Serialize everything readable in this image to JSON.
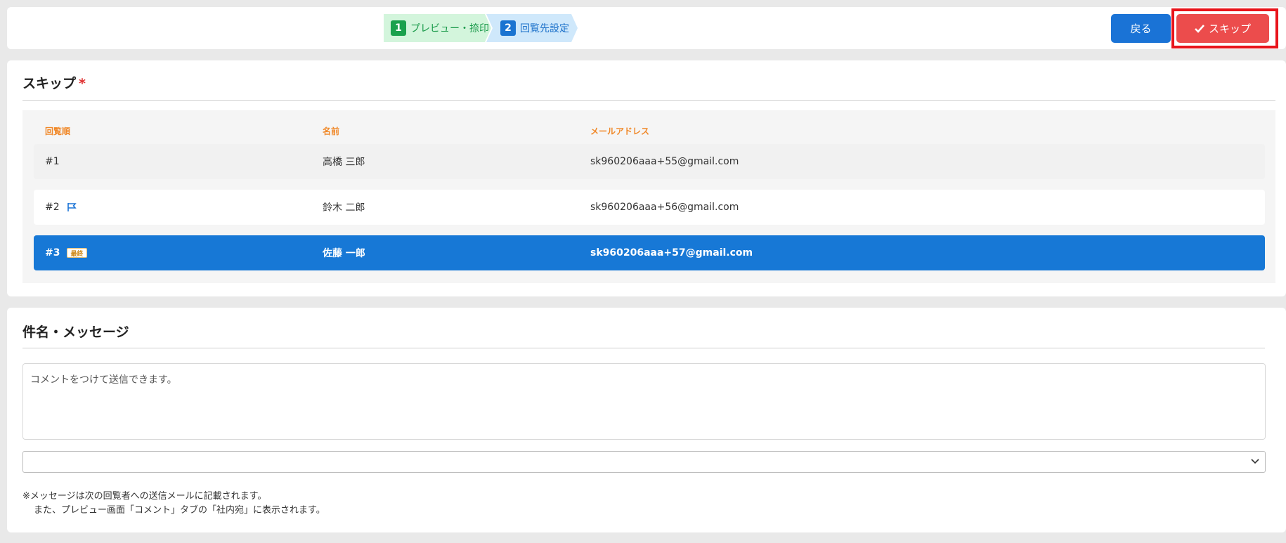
{
  "steps": [
    {
      "num": "1",
      "label": "プレビュー・捺印"
    },
    {
      "num": "2",
      "label": "回覧先設定"
    }
  ],
  "buttons": {
    "back": "戻る",
    "skip": "スキップ"
  },
  "colors": {
    "primary": "#1a73d6",
    "danger": "#ec4c4c",
    "highlight_outline": "#e8141b",
    "header_text": "#f0892a"
  },
  "skip_section": {
    "title": "スキップ",
    "required_mark": "*",
    "columns": [
      "回覧順",
      "名前",
      "メールアドレス"
    ],
    "rows": [
      {
        "order": "#1",
        "name": "高橋 三郎",
        "email": "sk960206aaa+55@gmail.com",
        "icon": "",
        "badge": "",
        "selected": false
      },
      {
        "order": "#2",
        "name": "鈴木 二郎",
        "email": "sk960206aaa+56@gmail.com",
        "icon": "flag-icon",
        "badge": "",
        "selected": false
      },
      {
        "order": "#3",
        "name": "佐藤 一郎",
        "email": "sk960206aaa+57@gmail.com",
        "icon": "",
        "badge": "最終",
        "selected": true
      }
    ]
  },
  "message_section": {
    "title": "件名・メッセージ",
    "comment_placeholder": "コメントをつけて送信できます。",
    "select_value": "",
    "note_line1": "※メッセージは次の回覧者への送信メールに記載されます。",
    "note_line2": "また、プレビュー画面「コメント」タブの「社内宛」に表示されます。"
  }
}
